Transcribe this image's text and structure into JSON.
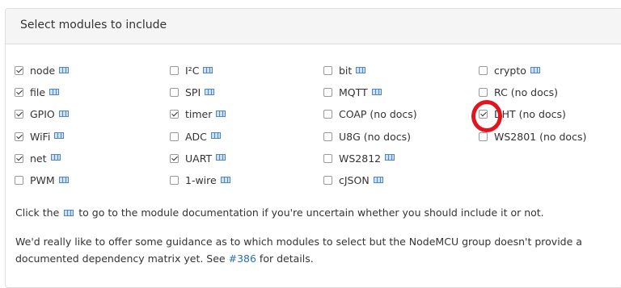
{
  "panel": {
    "title": "Select modules to include"
  },
  "modules": [
    {
      "label": "node",
      "checked": true,
      "docs": true
    },
    {
      "label": "I²C",
      "checked": false,
      "docs": true
    },
    {
      "label": "bit",
      "checked": false,
      "docs": true
    },
    {
      "label": "crypto",
      "checked": false,
      "docs": true
    },
    {
      "label": "file",
      "checked": true,
      "docs": true
    },
    {
      "label": "SPI",
      "checked": false,
      "docs": true
    },
    {
      "label": "MQTT",
      "checked": false,
      "docs": true
    },
    {
      "label": "RC (no docs)",
      "checked": false,
      "docs": false
    },
    {
      "label": "GPIO",
      "checked": true,
      "docs": true
    },
    {
      "label": "timer",
      "checked": true,
      "docs": true
    },
    {
      "label": "COAP (no docs)",
      "checked": false,
      "docs": false
    },
    {
      "label": "DHT (no docs)",
      "checked": true,
      "docs": false
    },
    {
      "label": "WiFi",
      "checked": true,
      "docs": true
    },
    {
      "label": "ADC",
      "checked": false,
      "docs": true
    },
    {
      "label": "U8G (no docs)",
      "checked": false,
      "docs": false
    },
    {
      "label": "WS2801 (no docs)",
      "checked": false,
      "docs": false
    },
    {
      "label": "net",
      "checked": true,
      "docs": true
    },
    {
      "label": "UART",
      "checked": true,
      "docs": true
    },
    {
      "label": "WS2812",
      "checked": false,
      "docs": true
    },
    {
      "label": "",
      "checked": null,
      "docs": false
    },
    {
      "label": "PWM",
      "checked": false,
      "docs": true
    },
    {
      "label": "1-wire",
      "checked": false,
      "docs": true
    },
    {
      "label": "cJSON",
      "checked": false,
      "docs": true
    },
    {
      "label": "",
      "checked": null,
      "docs": false
    }
  ],
  "notes": {
    "line1_before": "Click the",
    "line1_after": "to go to the module documentation if you're uncertain whether you should include it or not.",
    "line2_before": "We'd really like to offer some guidance as to which modules to select but the NodeMCU group doesn't provide a documented dependency matrix yet. See",
    "line2_link": "#386",
    "line2_after": "for details."
  },
  "colors": {
    "highlight_ring": "#e3141b",
    "link": "#2a6fb0",
    "doc_icon": "#4a86c8"
  },
  "icons": {
    "doc": "book-icon",
    "highlight": "red-circle-annotation"
  }
}
